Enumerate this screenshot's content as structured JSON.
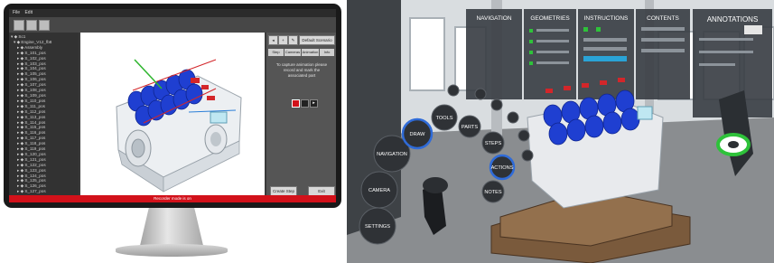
{
  "desktop": {
    "menu": [
      "File",
      "Edit"
    ],
    "tree_items": [
      "▾ ◆ Sc1",
      "▾ ◆ Engine_V12_fb8",
      "▸ ◆ Assembly",
      "▸ ◆ S_101_pos",
      "▸ ◆ S_102_pos",
      "▸ ◆ S_103_pos",
      "▸ ◆ S_104_pos",
      "▸ ◆ S_105_pos",
      "▸ ◆ S_106_pos",
      "▸ ◆ S_107_pos",
      "▸ ◆ S_108_pos",
      "▸ ◆ S_109_pos",
      "▸ ◆ S_110_pos",
      "▸ ◆ S_111_pos",
      "▸ ◆ S_112_pos",
      "▸ ◆ S_113_pos",
      "▸ ◆ S_114_pos",
      "▸ ◆ S_115_pos",
      "▸ ◆ S_116_pos",
      "▸ ◆ S_117_pos",
      "▸ ◆ S_118_pos",
      "▸ ◆ S_119_pos",
      "▸ ◆ S_120_pos",
      "▸ ◆ S_121_pos",
      "▸ ◆ S_122_pos",
      "▸ ◆ S_123_pos",
      "▸ ◆ S_124_pos",
      "▸ ◆ S_125_pos",
      "▸ ◆ S_126_pos",
      "▸ ◆ S_127_pos"
    ],
    "panel_dropdown": "Default Scenario",
    "panel_tabs": [
      "Step",
      "Cameras",
      "Animation",
      "Info"
    ],
    "panel_hint": "To capture animation please record and mark the associated part",
    "create_step": "Create Step",
    "exit": "Exit",
    "status": "Recorder mode is on",
    "colors": {
      "status_bar": "#d2111a",
      "engine_blue": "#1f3fd1"
    }
  },
  "vr": {
    "menu_tabs": [
      "NAVIGATION",
      "GEOMETRIES",
      "INSTRUCTIONS",
      "CONTENTS",
      "ANNOTATIONS"
    ],
    "circle_buttons": [
      "NAVIGATION",
      "CAMERA",
      "SETTINGS",
      "DRAW",
      "TOOLS",
      "PARTS",
      "STEPS",
      "ACTIONS",
      "NOTES"
    ],
    "colors": {
      "highlight": "#2f6bd8",
      "panel": "#3b3f45",
      "controller_green": "#2ec23a"
    }
  }
}
